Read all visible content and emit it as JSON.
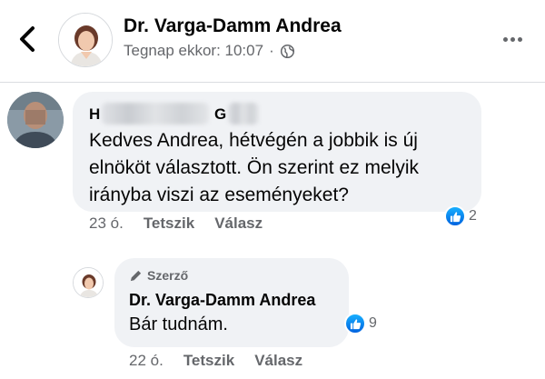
{
  "header": {
    "name": "Dr. Varga-Damm Andrea",
    "time": "Tegnap ekkor: 10:07",
    "separator": "·",
    "back_icon": "chevron-left-icon",
    "more_icon": "more-dots-icon"
  },
  "comment": {
    "name_first": "H",
    "name_second": "G",
    "text": "Kedves Andrea, hétvégén a jobbik is új elnököt választott. Ön szerint ez melyik irányba viszi az eseményeket?",
    "time": "23 ó.",
    "like_label": "Tetszik",
    "reply_label": "Válasz",
    "reaction_count": "2"
  },
  "reply": {
    "author_badge": "Szerző",
    "name": "Dr. Varga-Damm Andrea",
    "text": "Bár tudnám.",
    "time": "22 ó.",
    "like_label": "Tetszik",
    "reply_label": "Válasz",
    "reaction_count": "9"
  },
  "colors": {
    "accent": "#1877f2",
    "bubble": "#f0f2f5",
    "secondary_text": "#65676b"
  }
}
